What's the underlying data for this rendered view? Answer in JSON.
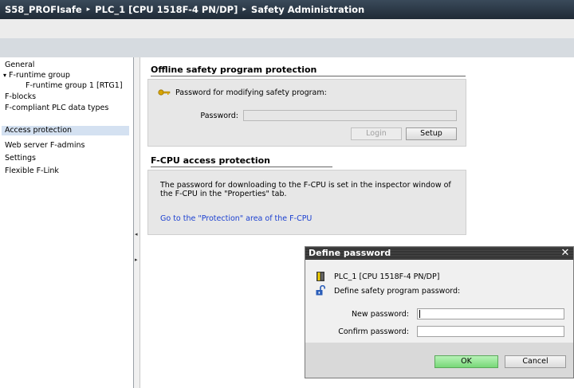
{
  "breadcrumb": {
    "project": "S58_PROFIsafe",
    "device": "PLC_1 [CPU 1518F-4 PN/DP]",
    "page": "Safety Administration",
    "separator": "▸"
  },
  "sidebar": {
    "items": [
      {
        "label": "General"
      },
      {
        "label": "F-runtime group",
        "expander": "▾"
      },
      {
        "label": "F-runtime group 1 [RTG1]"
      },
      {
        "label": "F-blocks"
      },
      {
        "label": "F-compliant PLC data types"
      },
      {
        "label": "Access protection",
        "selected": true
      },
      {
        "label": "Web server F-admins"
      },
      {
        "label": "Settings"
      },
      {
        "label": "Flexible F-Link"
      }
    ]
  },
  "splitter": {
    "collapse_left": "◂",
    "expand_right": "▸"
  },
  "offline": {
    "title": "Offline safety program protection",
    "key_label": "Password for modifying safety program:",
    "password_label": "Password:",
    "password_value": "",
    "login_label": "Login",
    "setup_label": "Setup"
  },
  "fcpu": {
    "title": "F-CPU access protection",
    "description": "The password for downloading to the F-CPU is set in the inspector window of the F-CPU in the \"Properties\" tab.",
    "link": "Go to the \"Protection\" area of the F-CPU"
  },
  "dialog": {
    "title": "Define password",
    "close": "✕",
    "device": "PLC_1 [CPU 1518F-4 PN/DP]",
    "define_label": "Define safety program password:",
    "new_password_label": "New password:",
    "new_password_value": "",
    "confirm_password_label": "Confirm password:",
    "confirm_password_value": "",
    "ok_label": "OK",
    "cancel_label": "Cancel"
  },
  "colors": {
    "titlebar": "#2b3846",
    "selected_item": "#d4e1f1",
    "link": "#1a3fd0",
    "ok_button": "#8fe08f",
    "key_icon": "#d8a400"
  }
}
